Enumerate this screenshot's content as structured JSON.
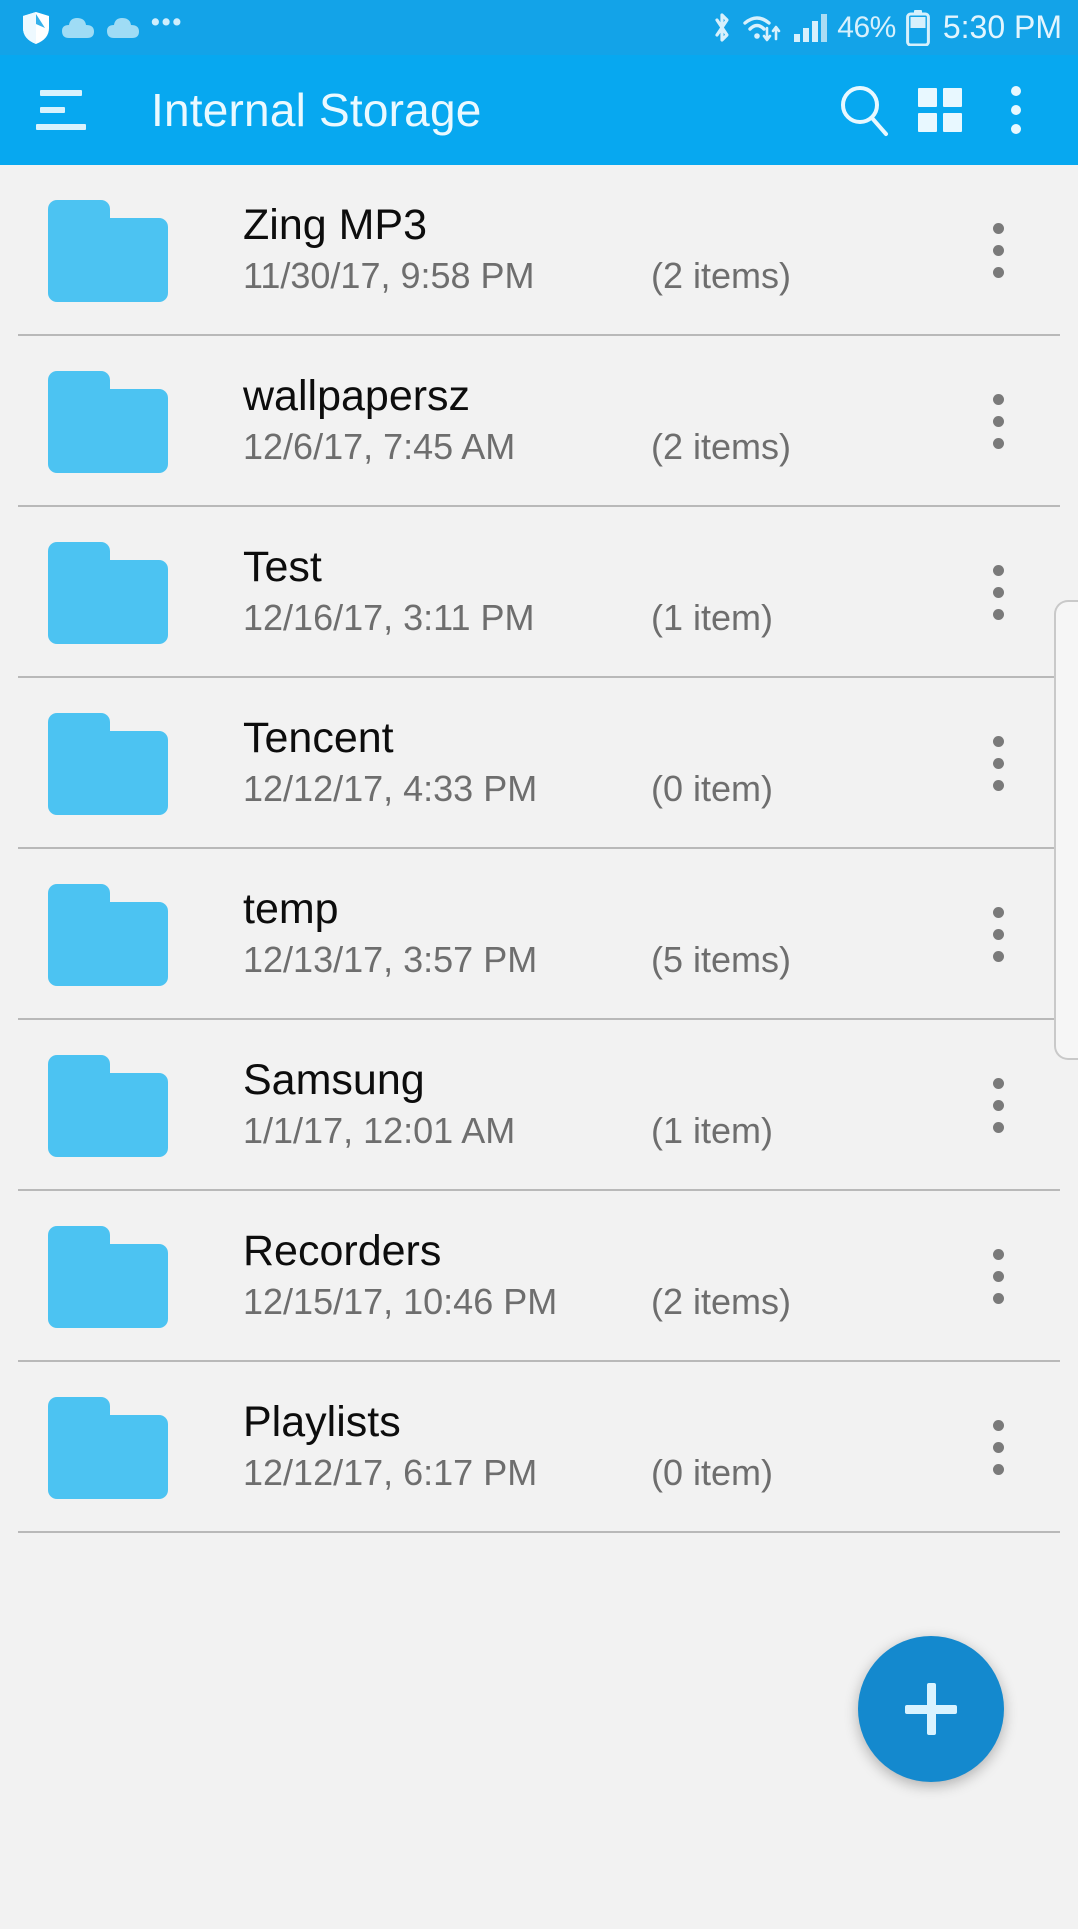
{
  "status_bar": {
    "left_icons": [
      "shield-icon",
      "cloud-icon",
      "cloud-icon"
    ],
    "overflow_glyph": "•••",
    "right_icons": [
      "bluetooth-icon",
      "wifi-icon",
      "signal-icon"
    ],
    "battery_percent": "46%",
    "time": "5:30 PM"
  },
  "app_bar": {
    "title": "Internal Storage",
    "menu_icon": "hamburger-list-icon",
    "search_icon": "search-icon",
    "grid_icon": "grid-view-icon",
    "overflow_icon": "more-vertical-icon"
  },
  "colors": {
    "status_bar": "#13A3E8",
    "app_bar": "#07A8F0",
    "folder": "#4CC3F2",
    "fab": "#1489CE",
    "page_bg": "#f2f2f2",
    "primary_text": "#0d0d0d",
    "secondary_text": "#6e6e6e"
  },
  "fab": {
    "label": "+",
    "name": "add-button"
  },
  "files": [
    {
      "name": "Zing MP3",
      "date": "11/30/17, 9:58 PM",
      "count": "(2 items)"
    },
    {
      "name": "wallpapersz",
      "date": "12/6/17, 7:45 AM",
      "count": "(2 items)"
    },
    {
      "name": "Test",
      "date": "12/16/17, 3:11 PM",
      "count": "(1 item)"
    },
    {
      "name": "Tencent",
      "date": "12/12/17, 4:33 PM",
      "count": "(0 item)"
    },
    {
      "name": "temp",
      "date": "12/13/17, 3:57 PM",
      "count": "(5 items)"
    },
    {
      "name": "Samsung",
      "date": "1/1/17, 12:01 AM",
      "count": "(1 item)"
    },
    {
      "name": "Recorders",
      "date": "12/15/17, 10:46 PM",
      "count": "(2 items)"
    },
    {
      "name": "Playlists",
      "date": "12/12/17, 6:17 PM",
      "count": "(0 item)"
    }
  ]
}
